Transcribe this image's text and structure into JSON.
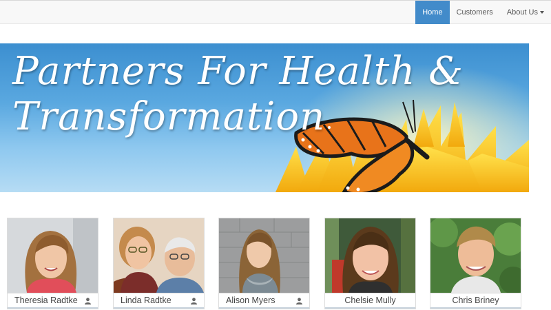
{
  "nav": {
    "items": [
      {
        "label": "Home",
        "active": true
      },
      {
        "label": "Customers",
        "active": false
      },
      {
        "label": "About Us",
        "active": false,
        "dropdown": true
      }
    ]
  },
  "banner": {
    "title_line1": "Partners For Health &",
    "title_line2": "Transformation"
  },
  "team": {
    "members": [
      {
        "name": "Theresia Radtke",
        "icon": "user-icon"
      },
      {
        "name": "Linda Radtke",
        "icon": "user-icon"
      },
      {
        "name": "Alison Myers",
        "icon": "user-icon"
      },
      {
        "name": "Chelsie Mully"
      },
      {
        "name": "Chris Briney"
      }
    ]
  },
  "colors": {
    "nav_active": "#428bca",
    "banner_sky": "#4a9ad8",
    "sunflower": "#f7c71a",
    "butterfly": "#e8731a"
  }
}
